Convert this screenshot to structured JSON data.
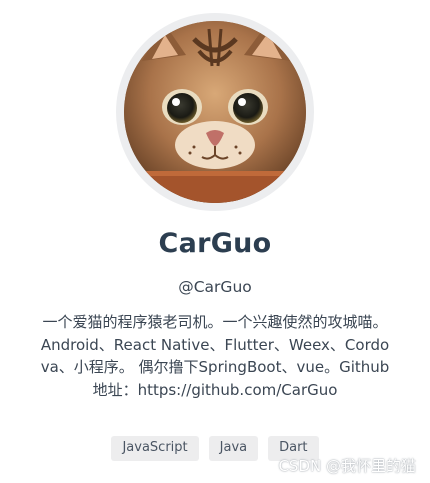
{
  "profile": {
    "name": "CarGuo",
    "handle": "@CarGuo",
    "bio": "一个爱猫的程序猿老司机。一个兴趣使然的攻城喵。Android、React Native、Flutter、Weex、Cordova、小程序。 偶尔撸下SpringBoot、vue。Github 地址：https://github.com/CarGuo",
    "avatar": "cat-avatar"
  },
  "tags": [
    "JavaScript",
    "Java",
    "Dart"
  ],
  "watermark": "CSDN @我怀里的猫",
  "colors": {
    "text": "#2c3e50",
    "tag_bg": "#ededee",
    "avatar_ring": "#ecedef"
  }
}
